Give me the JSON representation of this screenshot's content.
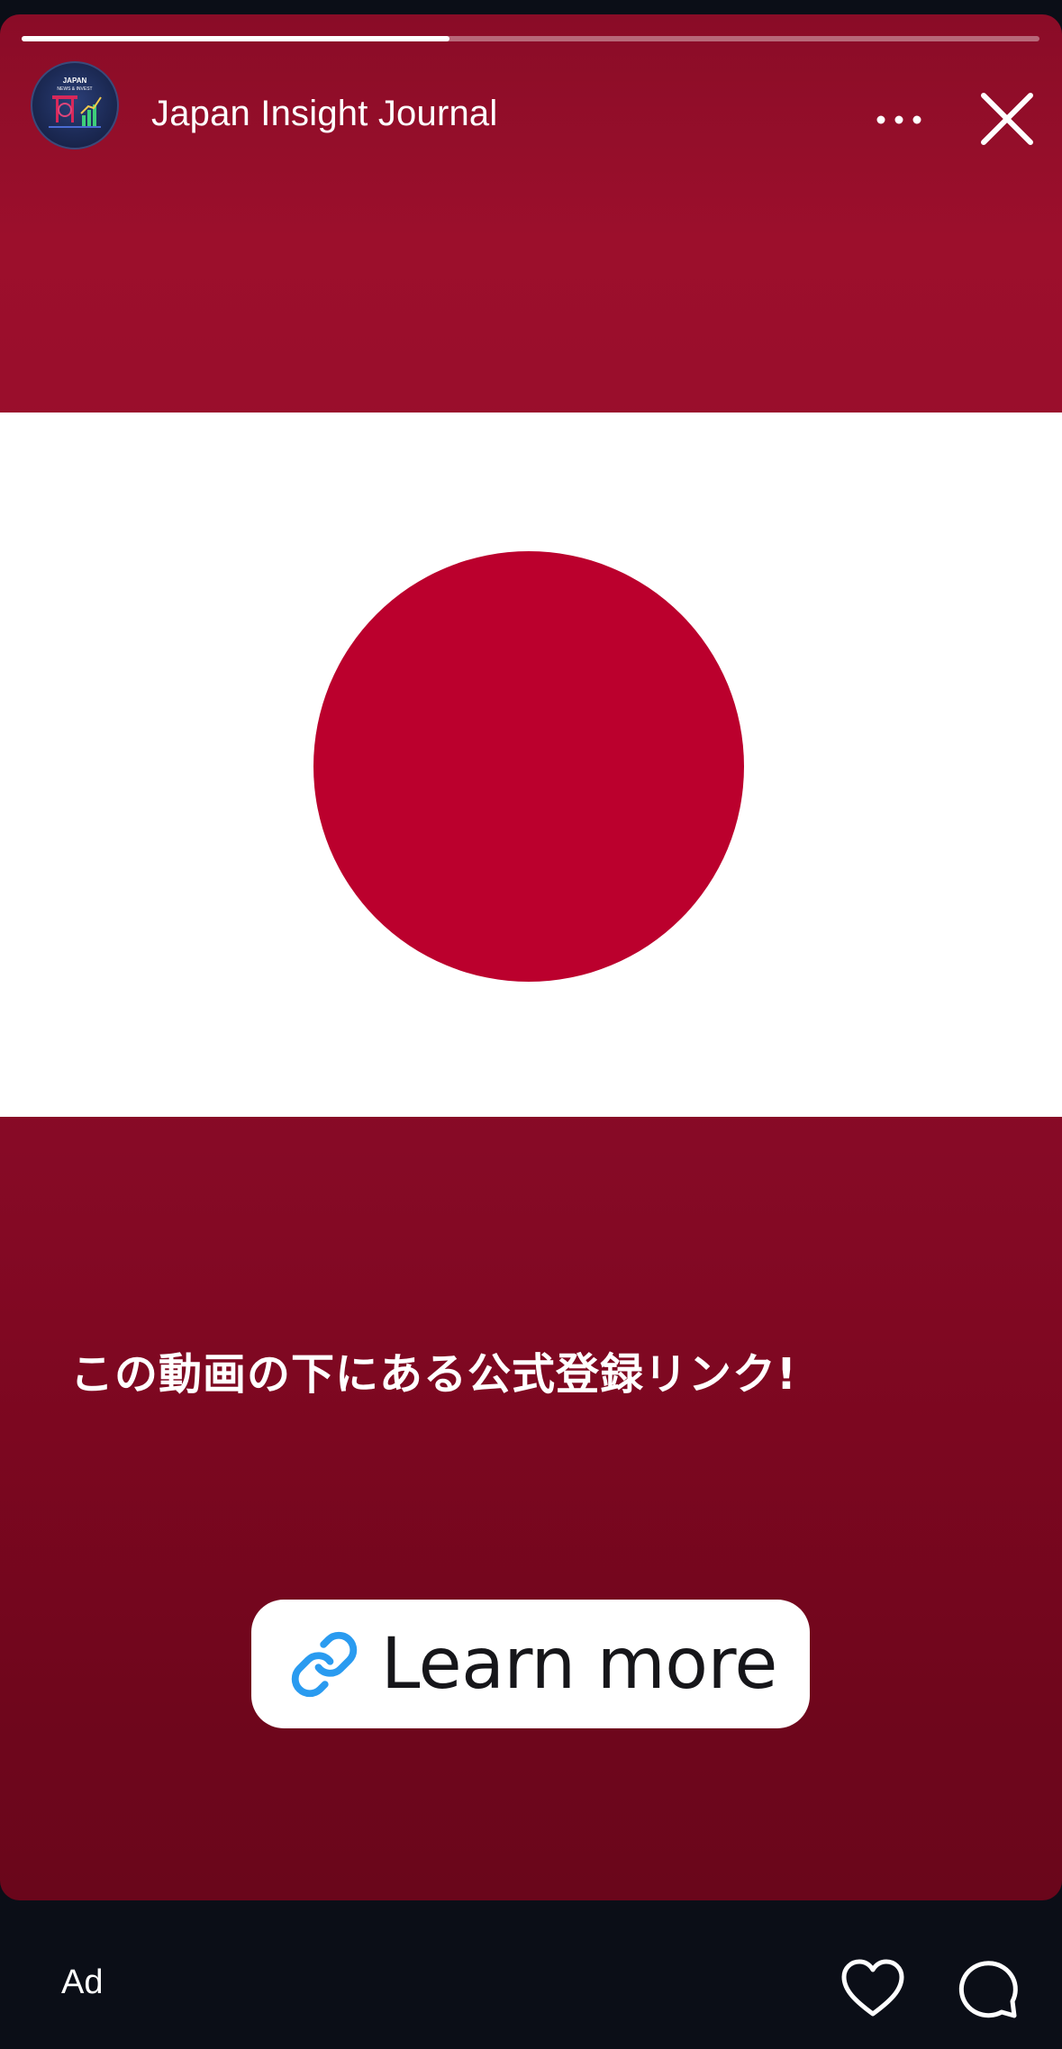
{
  "story": {
    "progress": 0.42,
    "account_name": "Japan Insight Journal",
    "avatar": {
      "lines": [
        "JAPAN",
        "NEWS & INVEST"
      ]
    },
    "caption": "この動画の下にある公式登録リンク!",
    "cta_label": "Learn more"
  },
  "bottom_bar": {
    "ad_label": "Ad"
  },
  "colors": {
    "story_background": "#8d0b28",
    "flag_disc": "#bb002d",
    "link_icon": "#2a9bf0",
    "app_background": "#0b0e17"
  },
  "icons": {
    "more": "more-horizontal-icon",
    "close": "close-icon",
    "link": "link-icon",
    "heart": "heart-icon",
    "comment": "comment-icon"
  }
}
